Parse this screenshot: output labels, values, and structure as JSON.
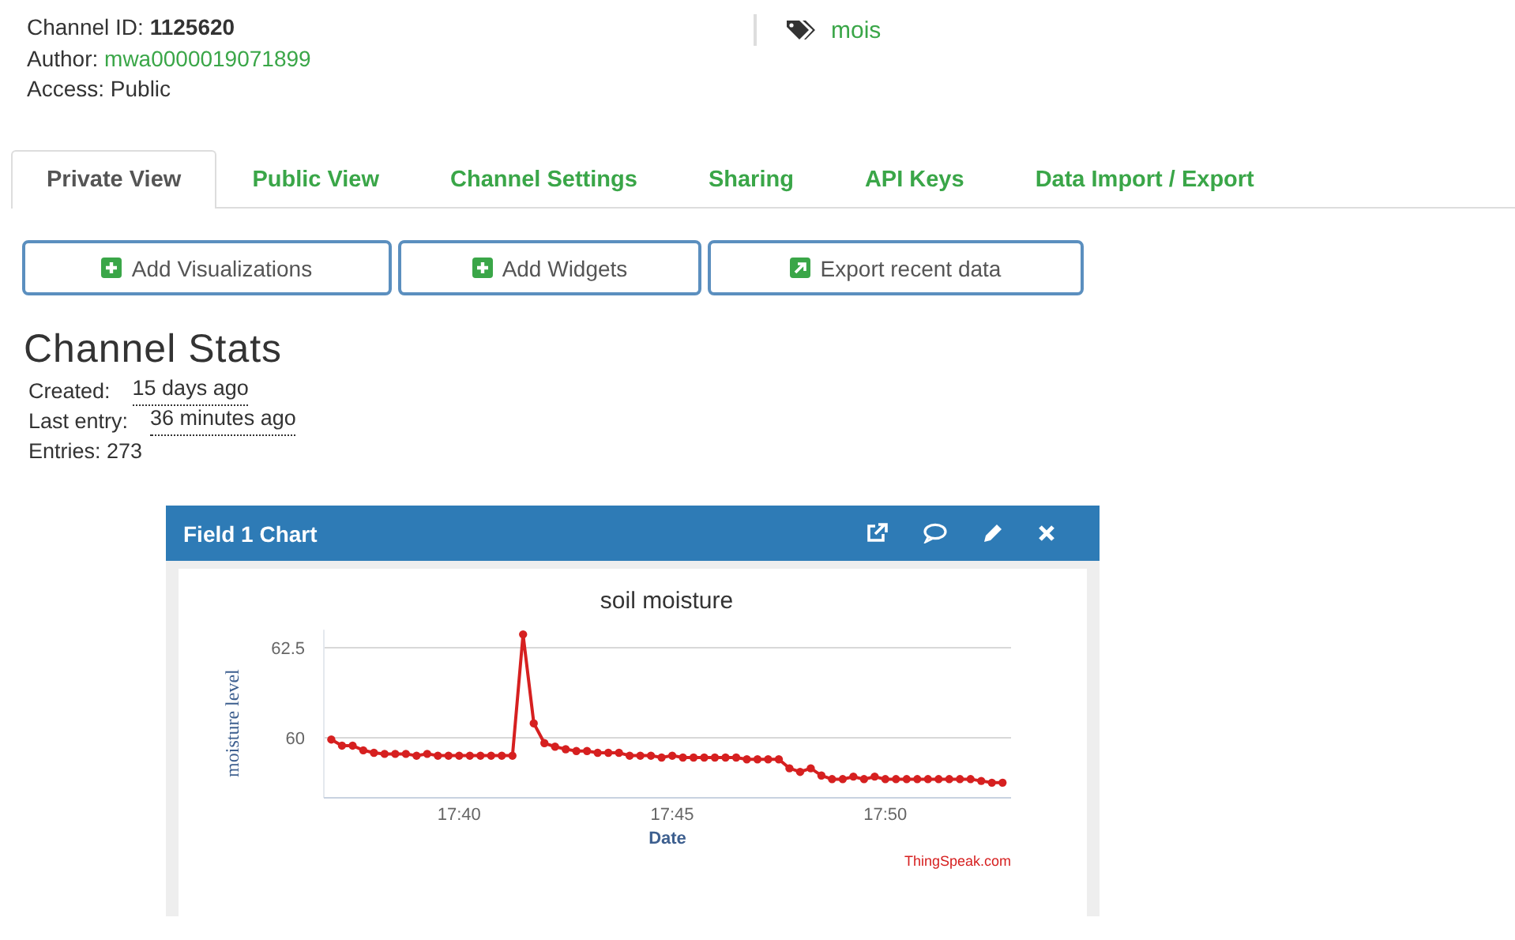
{
  "channel": {
    "id_label": "Channel ID:",
    "id": "1125620",
    "author_label": "Author:",
    "author": "mwa0000019071899",
    "access": "Access: Public",
    "tag": "mois"
  },
  "tabs": [
    {
      "label": "Private View",
      "selected": true
    },
    {
      "label": "Public View",
      "selected": false
    },
    {
      "label": "Channel Settings",
      "selected": false
    },
    {
      "label": "Sharing",
      "selected": false
    },
    {
      "label": "API Keys",
      "selected": false
    },
    {
      "label": "Data Import / Export",
      "selected": false
    }
  ],
  "buttons": [
    {
      "label": "Add Visualizations",
      "kind": "add"
    },
    {
      "label": "Add Widgets",
      "kind": "add"
    },
    {
      "label": "Export recent data",
      "kind": "export"
    }
  ],
  "stats": {
    "title": "Channel Stats",
    "rows": [
      {
        "label": "Created:",
        "value": "15 days ago"
      },
      {
        "label": "Last entry:",
        "value": "36 minutes ago"
      },
      {
        "label": "Entries: 273"
      }
    ]
  },
  "panel": {
    "title": "Field 1 Chart",
    "credit": "ThingSpeak.com",
    "chart_data": {
      "type": "line",
      "title": "soil moisture",
      "xlabel": "Date",
      "ylabel": "moisture level",
      "categories": [
        null,
        null,
        null,
        null,
        null,
        null,
        null,
        null,
        null,
        null,
        null,
        null,
        "17:40",
        null,
        null,
        null,
        null,
        null,
        null,
        null,
        null,
        null,
        null,
        null,
        null,
        null,
        null,
        null,
        null,
        null,
        null,
        null,
        "17:45",
        null,
        null,
        null,
        null,
        null,
        null,
        null,
        null,
        null,
        null,
        null,
        null,
        null,
        null,
        null,
        null,
        null,
        null,
        null,
        "17:50",
        null,
        null,
        null,
        null,
        null,
        null,
        null,
        null,
        null,
        null,
        null
      ],
      "series": [
        {
          "color": "#d62020",
          "marker": true,
          "values": [
            59.95,
            59.78,
            59.78,
            59.65,
            59.58,
            59.55,
            59.55,
            59.55,
            59.5,
            59.55,
            59.5,
            59.5,
            59.5,
            59.5,
            59.5,
            59.5,
            59.5,
            59.5,
            62.87,
            60.4,
            59.85,
            59.75,
            59.68,
            59.63,
            59.63,
            59.58,
            59.58,
            59.58,
            59.5,
            59.5,
            59.5,
            59.45,
            59.5,
            59.45,
            59.45,
            59.45,
            59.45,
            59.45,
            59.45,
            59.4,
            59.4,
            59.4,
            59.4,
            59.15,
            59.05,
            59.15,
            58.95,
            58.85,
            58.85,
            58.92,
            58.85,
            58.92,
            58.85,
            58.85,
            58.85,
            58.85,
            58.85,
            58.85,
            58.85,
            58.85,
            58.85,
            58.8,
            58.75,
            58.75
          ]
        }
      ],
      "ylim": [
        58.33,
        63
      ],
      "yticks": [
        {
          "value": 60,
          "label": "60"
        },
        {
          "value": 62.5,
          "label": "62.5"
        }
      ]
    }
  }
}
